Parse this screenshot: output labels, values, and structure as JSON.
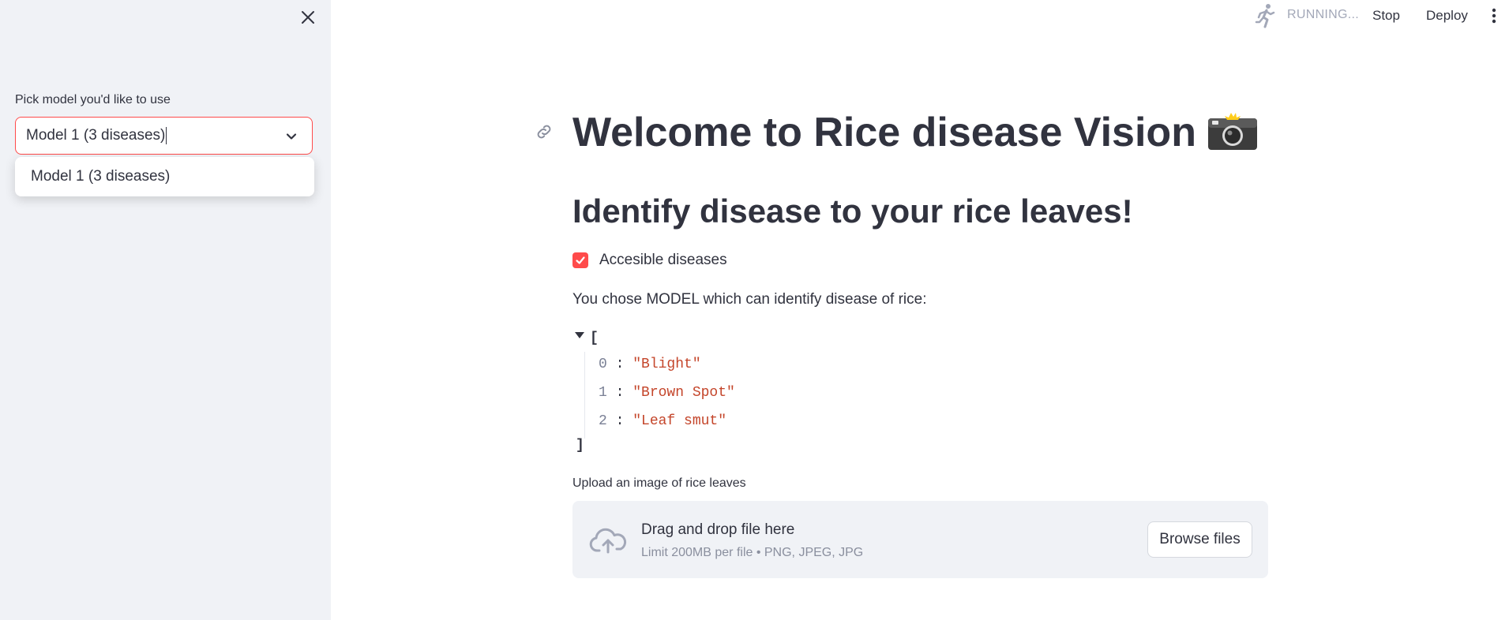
{
  "sidebar": {
    "close_icon": "close-icon",
    "select": {
      "label": "Pick model you'd like to use",
      "value": "Model 1 (3 diseases)",
      "options": [
        "Model 1 (3 diseases)"
      ]
    }
  },
  "toolbar": {
    "running_icon": "running-person-icon",
    "status": "RUNNING...",
    "stop_label": "Stop",
    "deploy_label": "Deploy",
    "menu_icon": "kebab-menu-icon"
  },
  "main": {
    "title": "Welcome to Rice disease Vision",
    "title_emoji": "camera-with-flash-icon",
    "subtitle": "Identify disease to your rice leaves!",
    "checkbox": {
      "label": "Accesible diseases",
      "checked": true
    },
    "paragraph": "You chose MODEL which can identify disease of rice:",
    "json_list": {
      "open": "[",
      "close": "]",
      "items": [
        {
          "index": "0",
          "value": "\"Blight\""
        },
        {
          "index": "1",
          "value": "\"Brown Spot\""
        },
        {
          "index": "2",
          "value": "\"Leaf smut\""
        }
      ]
    },
    "uploader": {
      "label": "Upload an image of rice leaves",
      "title": "Drag and drop file here",
      "subtitle": "Limit 200MB per file • PNG, JPEG, JPG",
      "button_label": "Browse files"
    }
  },
  "colors": {
    "accent": "#ff4b4b",
    "sidebar_bg": "#f0f2f6",
    "text": "#31333f",
    "json_string": "#c4452a"
  }
}
